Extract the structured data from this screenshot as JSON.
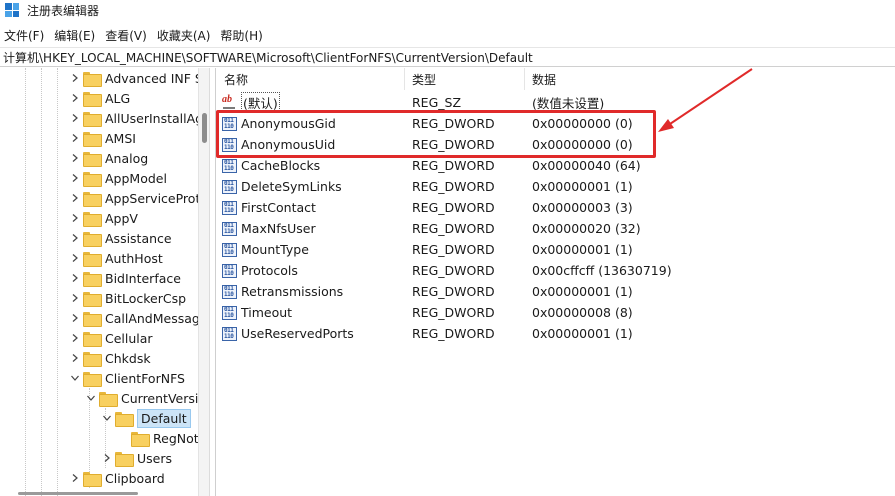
{
  "window": {
    "title": "注册表编辑器"
  },
  "menu": [
    "文件(F)",
    "编辑(E)",
    "查看(V)",
    "收藏夹(A)",
    "帮助(H)"
  ],
  "address": "计算机\\HKEY_LOCAL_MACHINE\\SOFTWARE\\Microsoft\\ClientForNFS\\CurrentVersion\\Default",
  "tree": [
    {
      "label": "Advanced INF S",
      "expanded": false
    },
    {
      "label": "ALG",
      "expanded": false
    },
    {
      "label": "AllUserInstallAg",
      "expanded": false
    },
    {
      "label": "AMSI",
      "expanded": false
    },
    {
      "label": "Analog",
      "expanded": false
    },
    {
      "label": "AppModel",
      "expanded": false
    },
    {
      "label": "AppServiceProto",
      "expanded": false
    },
    {
      "label": "AppV",
      "expanded": false
    },
    {
      "label": "Assistance",
      "expanded": false
    },
    {
      "label": "AuthHost",
      "expanded": false
    },
    {
      "label": "BidInterface",
      "expanded": false
    },
    {
      "label": "BitLockerCsp",
      "expanded": false
    },
    {
      "label": "CallAndMessag",
      "expanded": false
    },
    {
      "label": "Cellular",
      "expanded": false
    },
    {
      "label": "Chkdsk",
      "expanded": false
    },
    {
      "label": "ClientForNFS",
      "expanded": true
    },
    {
      "label": "CurrentVersio",
      "expanded": true
    },
    {
      "label": "Default",
      "expanded": true,
      "selected": true
    },
    {
      "label": "RegNot",
      "expanded": false
    },
    {
      "label": "Users",
      "expanded": false
    },
    {
      "label": "Clipboard",
      "expanded": false
    }
  ],
  "columns": {
    "name": "名称",
    "type": "类型",
    "data": "数据"
  },
  "values": [
    {
      "name": "(默认)",
      "type": "REG_SZ",
      "data": "(数值未设置)",
      "icon": "string-value-icon"
    },
    {
      "name": "AnonymousGid",
      "type": "REG_DWORD",
      "data": "0x00000000 (0)",
      "icon": "dword-value-icon"
    },
    {
      "name": "AnonymousUid",
      "type": "REG_DWORD",
      "data": "0x00000000 (0)",
      "icon": "dword-value-icon"
    },
    {
      "name": "CacheBlocks",
      "type": "REG_DWORD",
      "data": "0x00000040 (64)",
      "icon": "dword-value-icon"
    },
    {
      "name": "DeleteSymLinks",
      "type": "REG_DWORD",
      "data": "0x00000001 (1)",
      "icon": "dword-value-icon"
    },
    {
      "name": "FirstContact",
      "type": "REG_DWORD",
      "data": "0x00000003 (3)",
      "icon": "dword-value-icon"
    },
    {
      "name": "MaxNfsUser",
      "type": "REG_DWORD",
      "data": "0x00000020 (32)",
      "icon": "dword-value-icon"
    },
    {
      "name": "MountType",
      "type": "REG_DWORD",
      "data": "0x00000001 (1)",
      "icon": "dword-value-icon"
    },
    {
      "name": "Protocols",
      "type": "REG_DWORD",
      "data": "0x00cffcff (13630719)",
      "icon": "dword-value-icon"
    },
    {
      "name": "Retransmissions",
      "type": "REG_DWORD",
      "data": "0x00000001 (1)",
      "icon": "dword-value-icon"
    },
    {
      "name": "Timeout",
      "type": "REG_DWORD",
      "data": "0x00000008 (8)",
      "icon": "dword-value-icon"
    },
    {
      "name": "UseReservedPorts",
      "type": "REG_DWORD",
      "data": "0x00000001 (1)",
      "icon": "dword-value-icon"
    }
  ],
  "annotation": {
    "color": "#e02a2a"
  }
}
